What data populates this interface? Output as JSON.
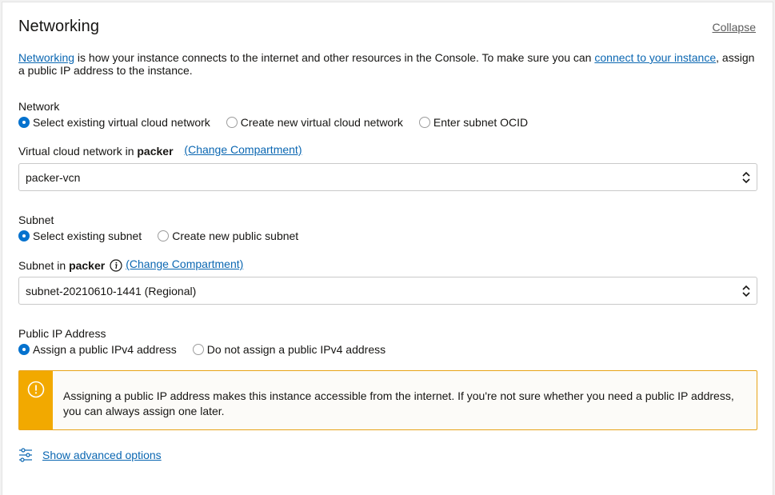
{
  "header": {
    "title": "Networking",
    "collapse_label": "Collapse"
  },
  "description": {
    "link1": "Networking",
    "text1": " is how your instance connects to the internet and other resources in the Console. To make sure you can ",
    "link2": "connect to your instance",
    "text2": ", assign a public IP address to the instance."
  },
  "network": {
    "label": "Network",
    "options": [
      {
        "label": "Select existing virtual cloud network",
        "checked": true
      },
      {
        "label": "Create new virtual cloud network",
        "checked": false
      },
      {
        "label": "Enter subnet OCID",
        "checked": false
      }
    ]
  },
  "vcn": {
    "label_prefix": "Virtual cloud network in ",
    "compartment": "packer",
    "change_link": "(Change Compartment)",
    "selected": "packer-vcn"
  },
  "subnet": {
    "label": "Subnet",
    "options": [
      {
        "label": "Select existing subnet",
        "checked": true
      },
      {
        "label": "Create new public subnet",
        "checked": false
      }
    ],
    "label_prefix": "Subnet in ",
    "compartment": "packer",
    "change_link": "(Change Compartment)",
    "selected": "subnet-20210610-1441 (Regional)"
  },
  "public_ip": {
    "label": "Public IP Address",
    "options": [
      {
        "label": "Assign a public IPv4 address",
        "checked": true
      },
      {
        "label": "Do not assign a public IPv4 address",
        "checked": false
      }
    ]
  },
  "alert": {
    "text": "Assigning a public IP address makes this instance accessible from the internet. If you're not sure whether you need a public IP address, you can always assign one later."
  },
  "advanced": {
    "label": "Show advanced options"
  },
  "colors": {
    "link": "#0b67b2",
    "radio_checked": "#0572ce",
    "warning": "#f2a900"
  }
}
